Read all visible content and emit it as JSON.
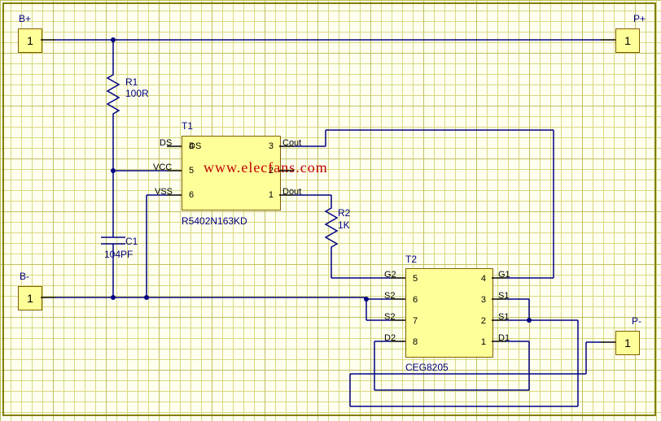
{
  "ports": {
    "bp": {
      "label": "B+",
      "pin": "1"
    },
    "bm": {
      "label": "B-",
      "pin": "1"
    },
    "pp": {
      "label": "P+",
      "pin": "1"
    },
    "pm": {
      "label": "P-",
      "pin": "1"
    }
  },
  "components": {
    "r1": {
      "ref": "R1",
      "value": "100R"
    },
    "r2": {
      "ref": "R2",
      "value": "1K"
    },
    "c1": {
      "ref": "C1",
      "value": "104PF"
    },
    "t1": {
      "ref": "T1",
      "part": "R5402N163KD",
      "pins_left": {
        "4": "DS",
        "5": "VCC",
        "6": "VSS"
      },
      "pins_right": {
        "3": "Cout",
        "2": "",
        "1": "Dout"
      }
    },
    "t2": {
      "ref": "T2",
      "part": "CEG8205",
      "pins_left": {
        "5": "G2",
        "6": "S2",
        "7": "S2",
        "8": "D2"
      },
      "pins_right": {
        "4": "G1",
        "3": "S1",
        "2": "S1",
        "1": "D1"
      }
    }
  },
  "watermark": "www.elecfans.com"
}
